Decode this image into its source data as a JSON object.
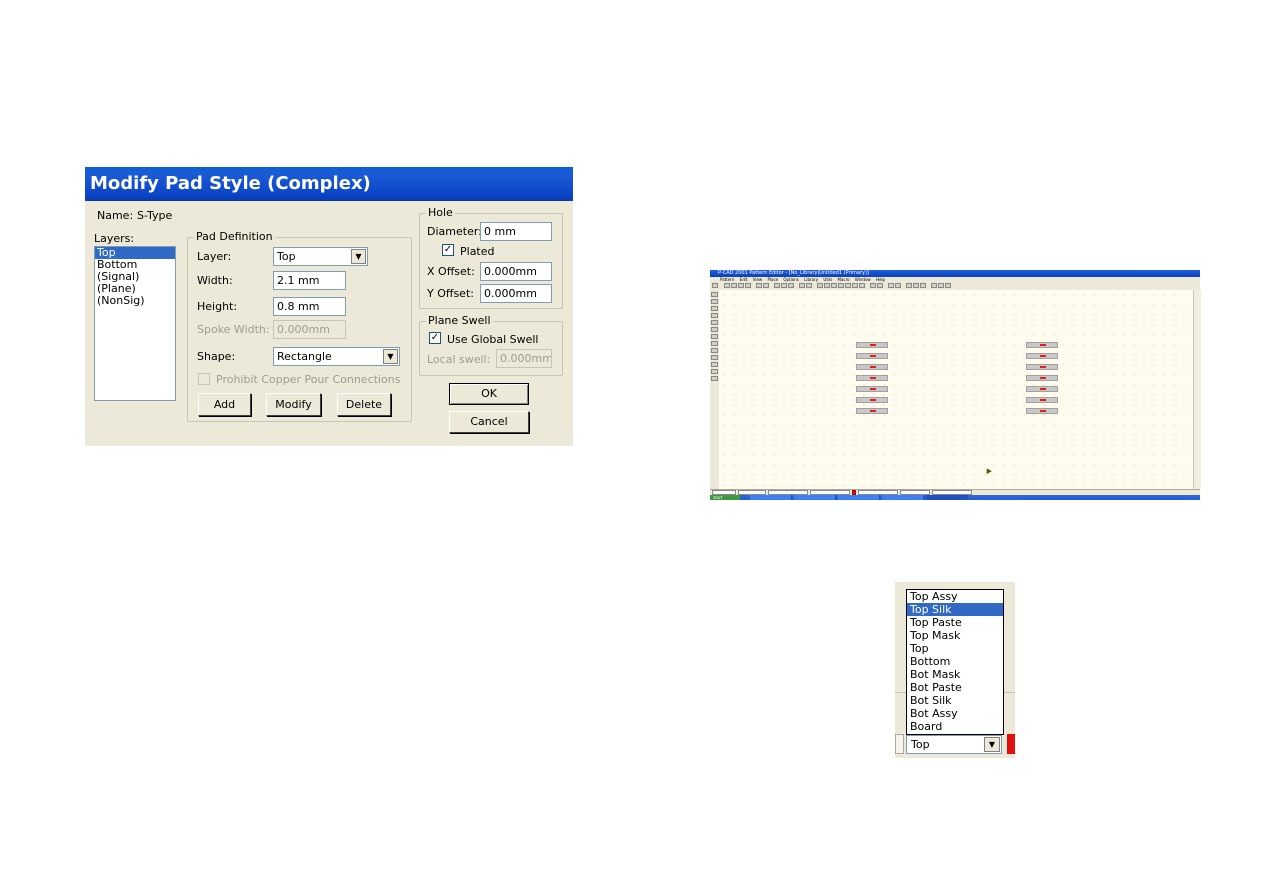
{
  "dialog": {
    "title": "Modify Pad Style (Complex)",
    "name_label": "Name:",
    "name_value": "S-Type",
    "layers_label": "Layers:",
    "layers": [
      "Top",
      "Bottom",
      "(Signal)",
      "(Plane)",
      "(NonSig)"
    ],
    "layers_selected": "Top",
    "pad_definition": {
      "title": "Pad Definition",
      "layer_label": "Layer:",
      "layer_value": "Top",
      "width_label": "Width:",
      "width_value": "2.1 mm",
      "height_label": "Height:",
      "height_value": "0.8 mm",
      "spoke_width_label": "Spoke Width:",
      "spoke_width_value": "0.000mm",
      "shape_label": "Shape:",
      "shape_value": "Rectangle",
      "prohibit_label": "Prohibit Copper Pour Connections",
      "add_label": "Add",
      "modify_label": "Modify",
      "delete_label": "Delete"
    },
    "hole": {
      "title": "Hole",
      "diameter_label": "Diameter:",
      "diameter_value": "0 mm",
      "plated_label": "Plated",
      "plated_checked": true,
      "xoffset_label": "X Offset:",
      "xoffset_value": "0.000mm",
      "yoffset_label": "Y Offset:",
      "yoffset_value": "0.000mm"
    },
    "plane_swell": {
      "title": "Plane Swell",
      "use_global_label": "Use Global Swell",
      "use_global_checked": true,
      "local_label": "Local swell:",
      "local_value": "0.000mm"
    },
    "ok_label": "OK",
    "cancel_label": "Cancel"
  },
  "pcad": {
    "title": "P-CAD 2001 Pattern Editor - [No_Library|Untitled1 (Primary)]",
    "menu": [
      "Pattern",
      "Edit",
      "View",
      "Place",
      "Options",
      "Library",
      "Utils",
      "Macro",
      "Window",
      "Help"
    ],
    "start_label": "start"
  },
  "layer_dropdown": {
    "items": [
      "Top Assy",
      "Top Silk",
      "Top Paste",
      "Top Mask",
      "Top",
      "Bottom",
      "Bot Mask",
      "Bot Paste",
      "Bot Silk",
      "Bot Assy",
      "Board"
    ],
    "highlighted": "Top Silk",
    "current_value": "Top"
  }
}
